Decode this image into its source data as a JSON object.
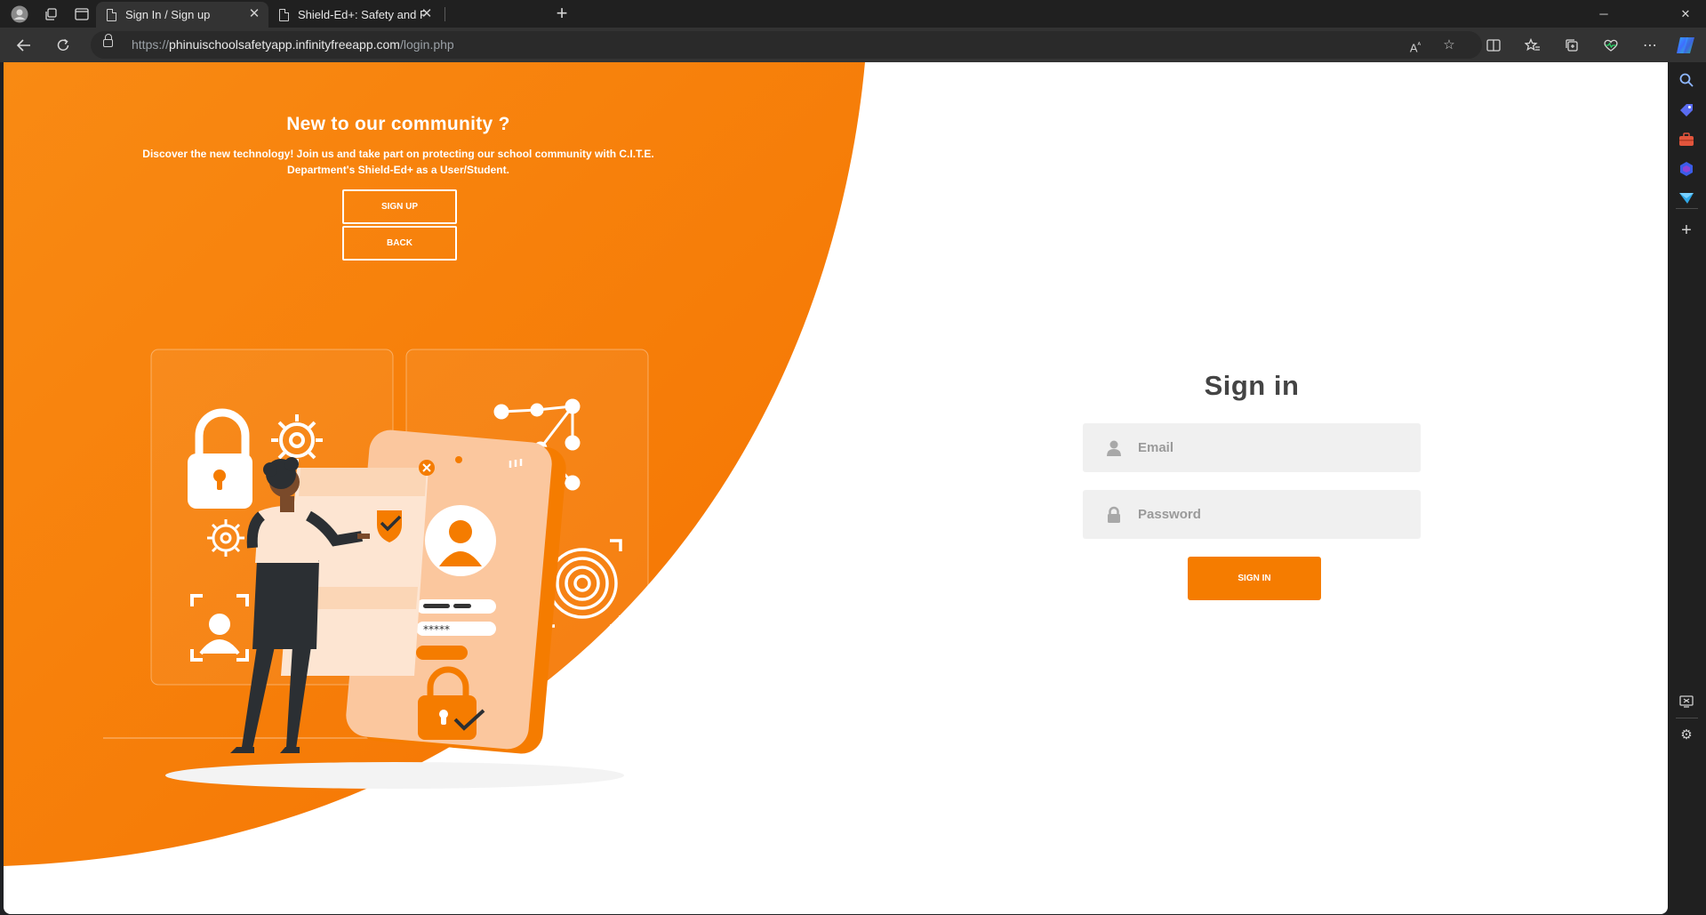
{
  "browser": {
    "tabs": [
      {
        "title": "Sign In / Sign up",
        "active": true
      },
      {
        "title": "Shield-Ed+: Safety and Preventio",
        "active": false
      }
    ],
    "url_prefix": "https://",
    "url_host": "phinuischoolsafetyapp.infinityfreeapp.com",
    "url_path": "/login.php"
  },
  "left_panel": {
    "heading": "New to our community ?",
    "description": "Discover the new technology! Join us and take part on protecting our school community with C.I.T.E. Department's Shield-Ed+ as a User/Student.",
    "signup_label": "SIGN UP",
    "back_label": "BACK"
  },
  "signin": {
    "title": "Sign in",
    "email_placeholder": "Email",
    "password_placeholder": "Password",
    "submit_label": "SIGN IN"
  },
  "colors": {
    "accent": "#f57c00",
    "panel_text": "#ffffff",
    "title_text": "#444444",
    "input_bg": "#f0f0f0"
  }
}
